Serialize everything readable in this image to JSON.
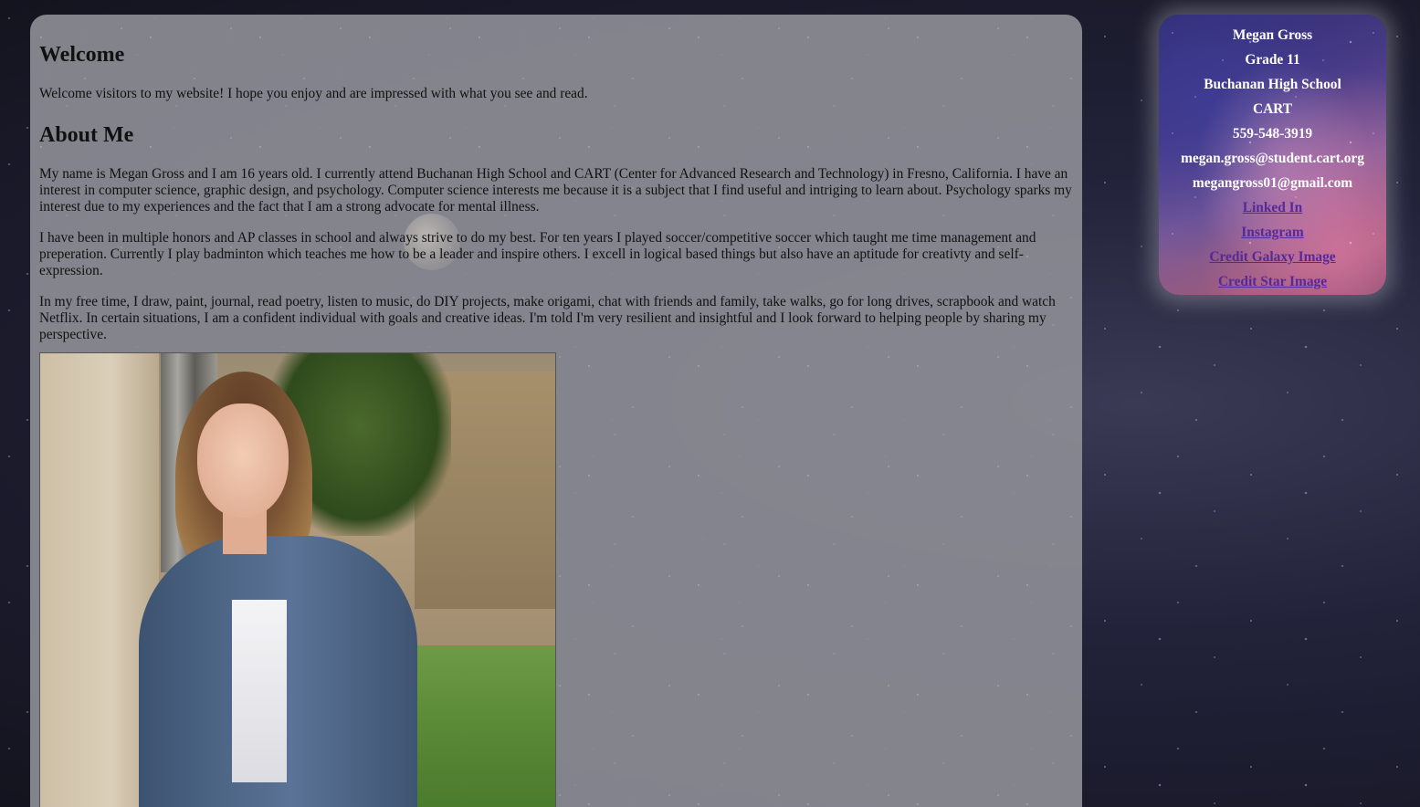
{
  "main": {
    "welcome_heading": "Welcome",
    "welcome_text": "Welcome visitors to my website! I hope you enjoy and are impressed with what you see and read.",
    "about_heading": "About Me",
    "about_paragraphs": [
      "My name is Megan Gross and I am 16 years old. I currently attend Buchanan High School and CART (Center for Advanced Research and Technology) in Fresno, California. I have an interest in computer science, graphic design, and psychology. Computer science interests me because it is a subject that I find useful and intriging to learn about. Psychology sparks my interest due to my experiences and the fact that I am a strong advocate for mental illness.",
      "I have been in multiple honors and AP classes in school and always strive to do my best. For ten years I played soccer/competitive soccer which taught me time management and preperation. Currently I play badminton which teaches me how to be a leader and inspire others. I excell in logical based things but also have an aptitude for creativty and self-expression.",
      "In my free time, I draw, paint, journal, read poetry, listen to music, do DIY projects, make origami, chat with friends and family, take walks, go for long drives, scrapbook and watch Netflix. In certain situations, I am a confident individual with goals and creative ideas. I'm told I'm very resilient and insightful and I look forward to helping people by sharing my perspective."
    ]
  },
  "sidebar": {
    "name": "Megan Gross",
    "grade": "Grade 11",
    "school": "Buchanan High School",
    "program": "CART",
    "phone": "559-548-3919",
    "school_email": "megan.gross@student.cart.org",
    "personal_email": "megangross01@gmail.com",
    "links": {
      "linkedin": "Linked In",
      "instagram": "Instagram",
      "credit_galaxy": "Credit Galaxy Image",
      "credit_star": "Credit Star Image"
    }
  },
  "colors": {
    "link": "#55299c",
    "panel": "#8c8c94"
  }
}
